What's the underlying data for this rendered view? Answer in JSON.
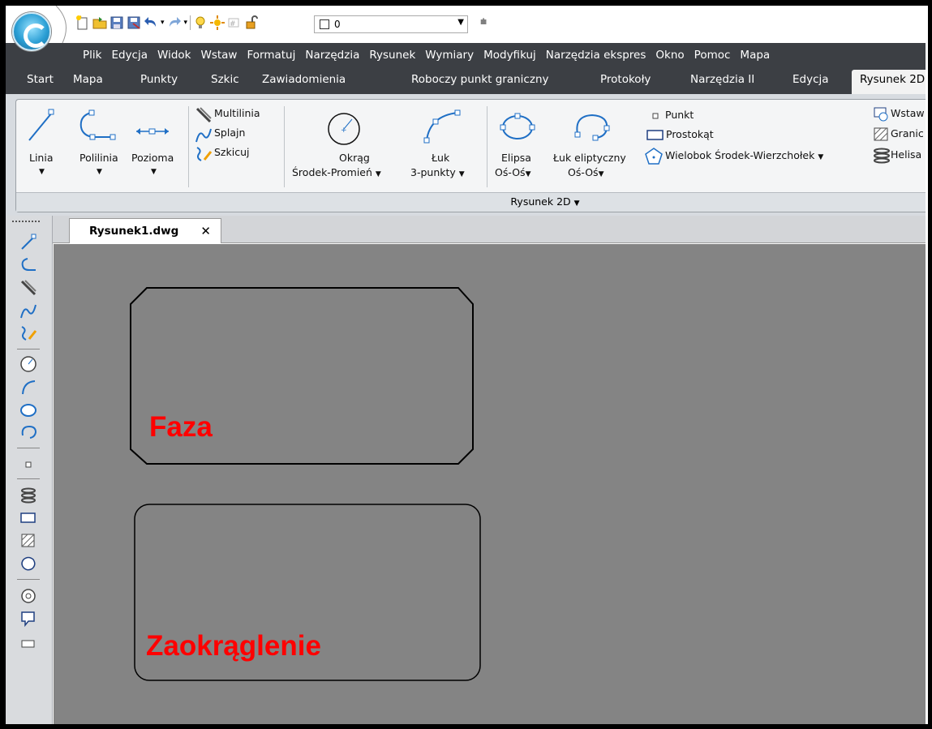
{
  "quick_access": {
    "layer_value": "0"
  },
  "menu": [
    "Plik",
    "Edycja",
    "Widok",
    "Wstaw",
    "Formatuj",
    "Narzędzia",
    "Rysunek",
    "Wymiary",
    "Modyfikuj",
    "Narzędzia ekspres",
    "Okno",
    "Pomoc",
    "Mapa"
  ],
  "tabs": {
    "items": [
      "Start",
      "Mapa",
      "Punkty",
      "Szkic",
      "Zawiadomienia",
      "Roboczy punkt graniczny",
      "Protokoły",
      "Narzędzia II",
      "Edycja"
    ],
    "active": "Rysunek 2D"
  },
  "ribbon": {
    "linia": "Linia",
    "polilinia": "Polilinia",
    "pozioma": "Pozioma",
    "multilinia": "Multilinia",
    "splajn": "Splajn",
    "szkicuj": "Szkicuj",
    "okrag_1": "Okrąg",
    "okrag_2": "Środek-Promień",
    "luk_1": "Łuk",
    "luk_2": "3-punkty",
    "elipsa_1": "Elipsa",
    "elipsa_2": "Oś-Oś",
    "luk_elip_1": "Łuk eliptyczny",
    "luk_elip_2": "Oś-Oś",
    "punkt": "Punkt",
    "prostokat": "Prostokąt",
    "wielobok": "Wielobok Środek-Wierzchołek",
    "wstaw": "Wstaw",
    "granic": "Granic",
    "helisa": "Helisa",
    "panel_title": "Rysunek 2D"
  },
  "document": {
    "tab_name": "Rysunek1.dwg",
    "close": "✕"
  },
  "drawing": {
    "chamfer_label": "Faza",
    "fillet_label": "Zaokrąglenie",
    "label_color": "#ff0000"
  },
  "colors": {
    "menu_bg": "#3c3f44",
    "canvas_bg": "#848484"
  }
}
